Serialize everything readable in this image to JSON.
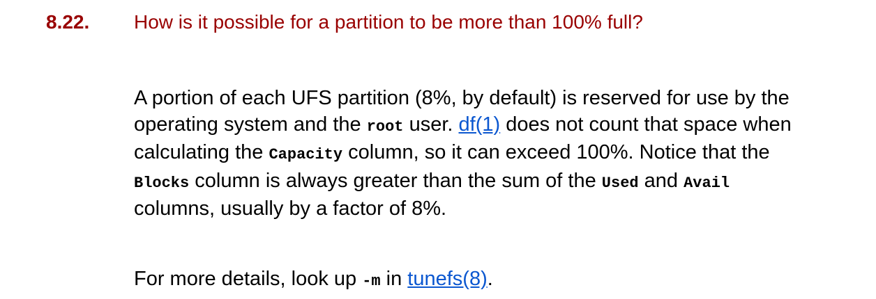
{
  "question": {
    "number": "8.22.",
    "title": "How is it possible for a partition to be more than 100% full?"
  },
  "answer": {
    "p1": {
      "t1": "A portion of each UFS partition (8%, by default) is reserved for use by the operating system and the ",
      "code_root": "root",
      "t2": " user. ",
      "link_df": "df(1)",
      "t3": " does not count that space when calculating the ",
      "code_capacity": "Capacity",
      "t4": " column, so it can exceed 100%. Notice that the ",
      "code_blocks": "Blocks",
      "t5": " column is always greater than the sum of the ",
      "code_used": "Used",
      "t6": " and ",
      "code_avail": "Avail",
      "t7": " columns, usually by a factor of 8%."
    },
    "p2": {
      "t1": "For more details, look up ",
      "code_m": "-m",
      "t2": " in ",
      "link_tunefs": "tunefs(8)",
      "t3": "."
    }
  },
  "colors": {
    "heading": "#990000",
    "link": "#0b57d0",
    "text": "#000000"
  }
}
